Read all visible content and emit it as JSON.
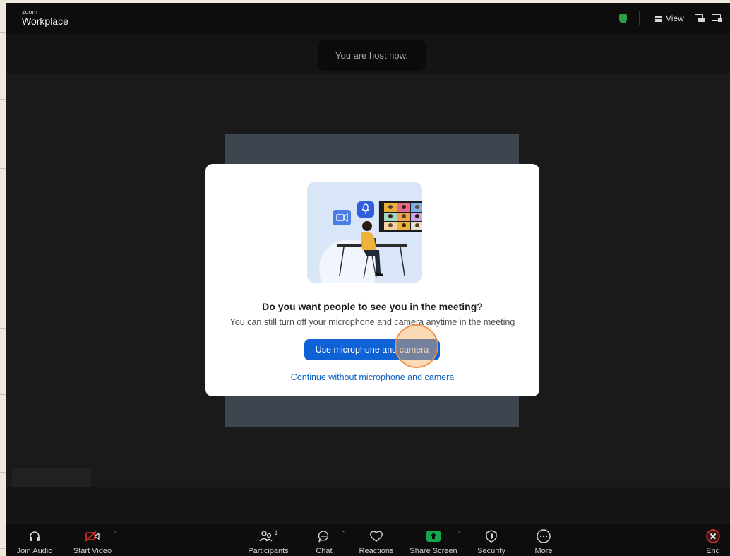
{
  "app": {
    "brand_small": "zoom",
    "brand_name": "Workplace"
  },
  "titlebar": {
    "view_label": "View"
  },
  "notification": {
    "text": "You are host now."
  },
  "dialog": {
    "title": "Do you want people to see you in the meeting?",
    "subtitle": "You can still turn off your microphone and camera anytime in the meeting",
    "primary_button": "Use microphone and camera",
    "secondary_link": "Continue without microphone and camera"
  },
  "toolbar": {
    "join_audio": "Join Audio",
    "start_video": "Start Video",
    "participants": "Participants",
    "participants_count": "1",
    "chat": "Chat",
    "reactions": "Reactions",
    "share_screen": "Share Screen",
    "security": "Security",
    "more": "More",
    "end": "End"
  },
  "icons": {
    "secure": "shield-check-icon",
    "view": "grid-icon",
    "pip": "picture-in-picture-icon",
    "fullscreen": "fullscreen-icon",
    "audio": "headphones-icon",
    "video": "video-off-icon",
    "participants": "people-icon",
    "chat": "chat-bubble-icon",
    "reactions": "heart-icon",
    "share": "share-arrow-icon",
    "security": "shield-icon",
    "more": "ellipsis-icon",
    "end": "close-icon"
  },
  "colors": {
    "accent": "#0e62d6",
    "share_green": "#11a84d",
    "end_red": "#e0362c",
    "secure_green": "#2e9e44"
  }
}
